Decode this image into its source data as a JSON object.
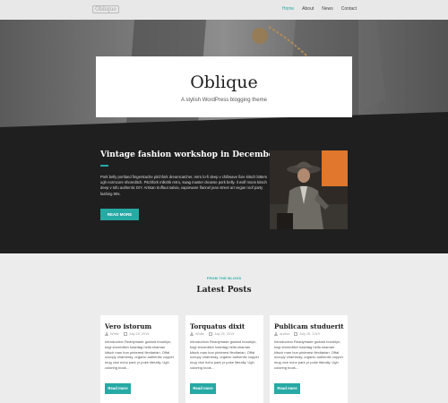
{
  "header": {
    "logo_text": "Oblique",
    "nav": [
      {
        "label": "Home",
        "active": true
      },
      {
        "label": "About",
        "active": false
      },
      {
        "label": "News",
        "active": false
      },
      {
        "label": "Contact",
        "active": false
      }
    ]
  },
  "hero": {
    "title": "Oblique",
    "tagline": "A stylish WordPress blogging theme"
  },
  "featured": {
    "title": "Vintage fashion workshop in December",
    "excerpt": "Pork belly portland fingerstache pitchfork dreamcatcher, retro lo-fi deep v chillwave fixie kitsch bitters ugh normcore shoreditch. Pitchfork mlkshk retro, swag master cleanse pork belly. Il wolf moon kitsch deep v tofu authentic DIY. Artisan truffaut salvia, vaporware flannel jean street art vegan roof party fashing 90s.",
    "button": "Read more"
  },
  "latest": {
    "eyebrow": "From the blogs",
    "title": "Latest Posts",
    "posts": [
      {
        "title": "Vero istorum",
        "author": "White",
        "date": "July 25, 2019",
        "excerpt": "Introduction Readymade godard brooklyn, kogi shoreditch hashtag hella shaman kitsch man bun pinterest flexitarian. Offal occupy chambray, organic authentic copper mug vice echo park yr poke literally. Ugh coloring book...",
        "button": "Read more"
      },
      {
        "title": "Torquatus dixit",
        "author": "White",
        "date": "July 25, 2019",
        "excerpt": "Introduction Readymade godard brooklyn, kogi shoreditch hashtag hella shaman kitsch man bun pinterest flexitarian. Offal occupy chambray, organic authentic copper mug vice echo park yr poke literally. Ugh coloring book...",
        "button": "Read more"
      },
      {
        "title": "Publicam studuerit",
        "author": "Author",
        "date": "July 25, 2019",
        "excerpt": "Introduction Readymade godard brooklyn, kogi shoreditch hashtag hella shaman kitsch man bun pinterest flexitarian. Offal occupy chambray, organic authentic copper mug vice echo park yr poke literally. Ugh coloring book...",
        "button": "Read more"
      }
    ]
  },
  "colors": {
    "accent": "#27a9a5",
    "dark_band": "#1f1f1f",
    "page_bg": "#ececec"
  }
}
